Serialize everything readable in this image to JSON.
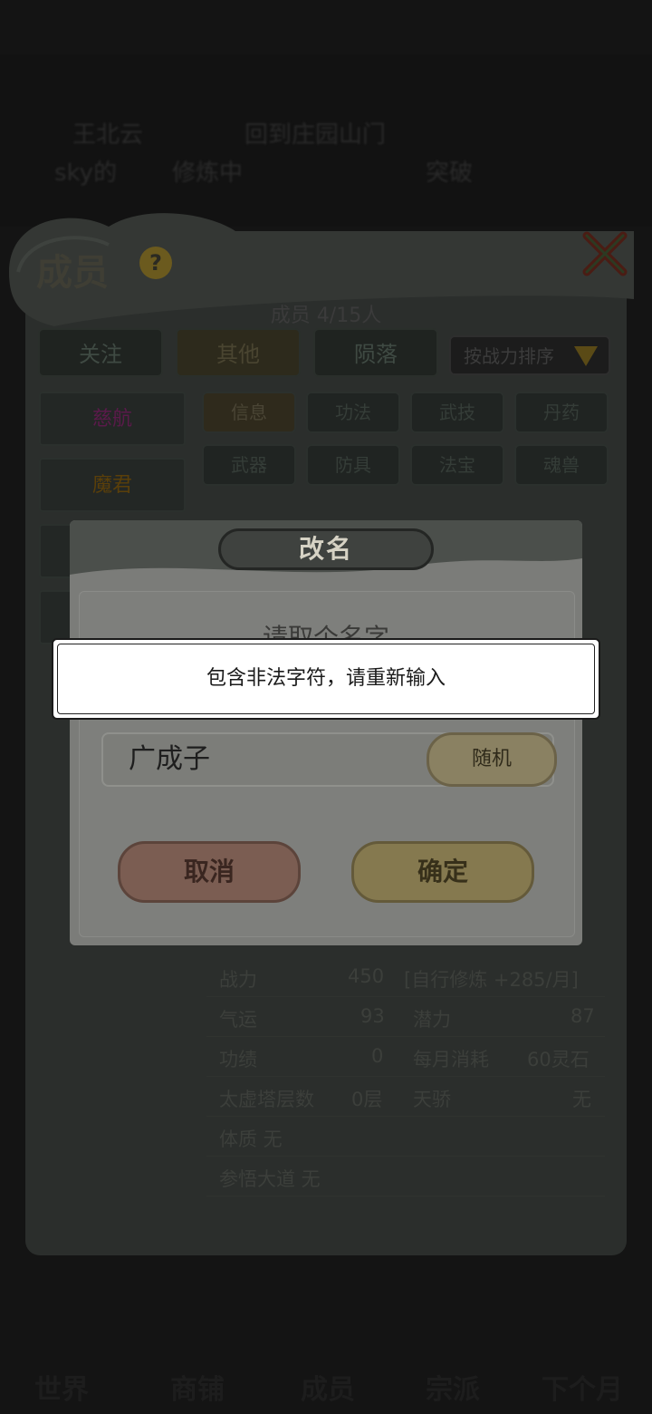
{
  "background": {
    "top_blur_texts": [
      "王北云",
      "回到庄园山门",
      "sky的",
      "修炼中",
      "突破"
    ],
    "panel_title": "成员",
    "help_icon": "?",
    "members_count": "成员  4/15人",
    "tabs": [
      "关注",
      "其他",
      "陨落"
    ],
    "sort_label": "按战力排序",
    "side_items": [
      {
        "label": "慈航",
        "color": "#5a1a4a"
      },
      {
        "label": "魔君",
        "color": "#5a3f0a"
      },
      {
        "label": ""
      },
      {
        "label": ""
      }
    ],
    "sub_tabs": [
      "信息",
      "功法",
      "武技",
      "丹药",
      "武器",
      "防具",
      "法宝",
      "魂兽"
    ],
    "stats": [
      {
        "label": "战力",
        "value": "450",
        "label2": "[自行修炼 +285/月]",
        "value2": ""
      },
      {
        "label": "气运",
        "value": "93",
        "label2": "潜力",
        "value2": "87"
      },
      {
        "label": "功绩",
        "value": "0",
        "label2": "每月消耗",
        "value2": "60灵石"
      },
      {
        "label": "太虚塔层数",
        "value": "0层",
        "label2": "天骄",
        "value2": "无"
      },
      {
        "label": "体质 无",
        "value": "",
        "label2": "",
        "value2": ""
      },
      {
        "label": "参悟大道 无",
        "value": "",
        "label2": "",
        "value2": ""
      }
    ],
    "bottom_nav": [
      "世界",
      "商铺",
      "成员",
      "宗派",
      "下个月"
    ]
  },
  "dialog": {
    "title": "改名",
    "prompt": "请取个名字",
    "input_value": "广成子",
    "random_label": "随机",
    "cancel_label": "取消",
    "confirm_label": "确定"
  },
  "toast": {
    "message": "包含非法字符，请重新输入"
  }
}
